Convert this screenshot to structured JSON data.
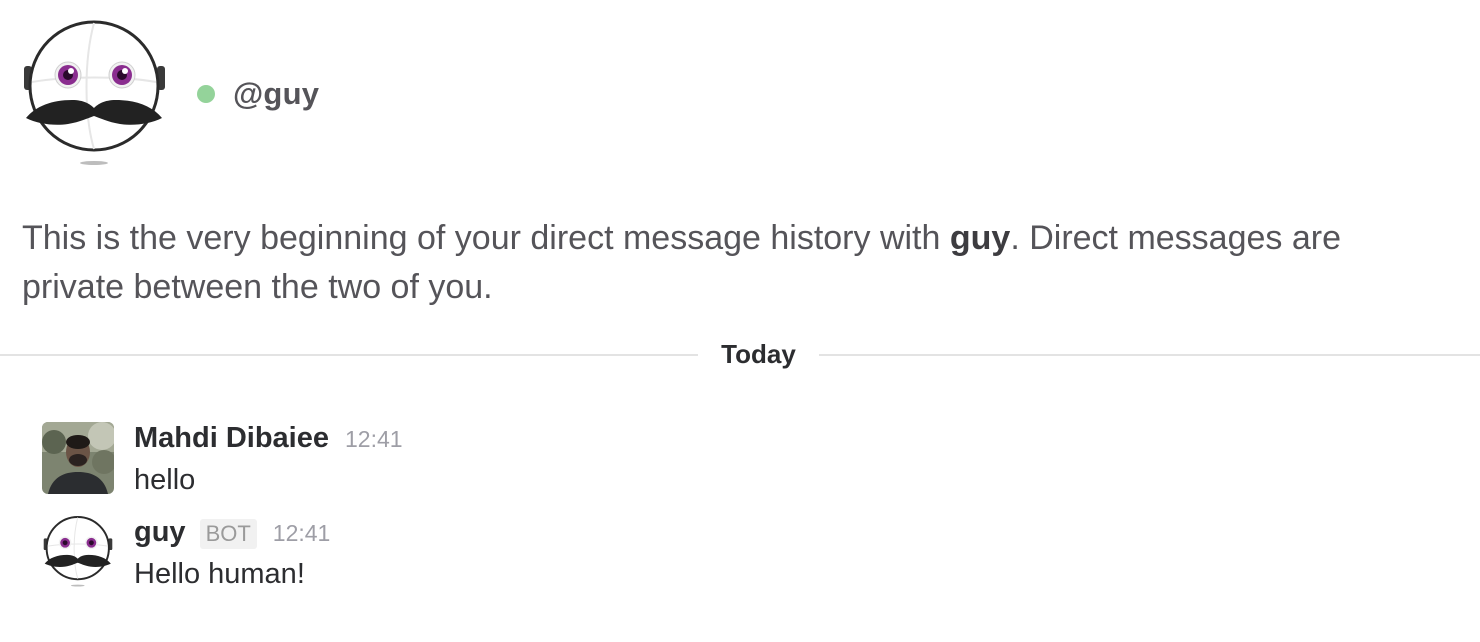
{
  "intro": {
    "handle": "@guy",
    "text_before": "This is the very beginning of your direct message history with ",
    "bold_name": "guy",
    "text_after": ". Direct messages are private between the two of you."
  },
  "divider": {
    "label": "Today"
  },
  "messages": [
    {
      "sender": "Mahdi Dibaiee",
      "time": "12:41",
      "text": "hello"
    },
    {
      "sender": "guy",
      "badge": "BOT",
      "time": "12:41",
      "text": "Hello human!"
    }
  ],
  "colors": {
    "presence": "#94d39a",
    "avatar_eye": "#8a2d8f",
    "mustache": "#222222"
  },
  "icons": {
    "bot_avatar": "robot-mustache-icon",
    "user_avatar": "user-photo-avatar"
  }
}
